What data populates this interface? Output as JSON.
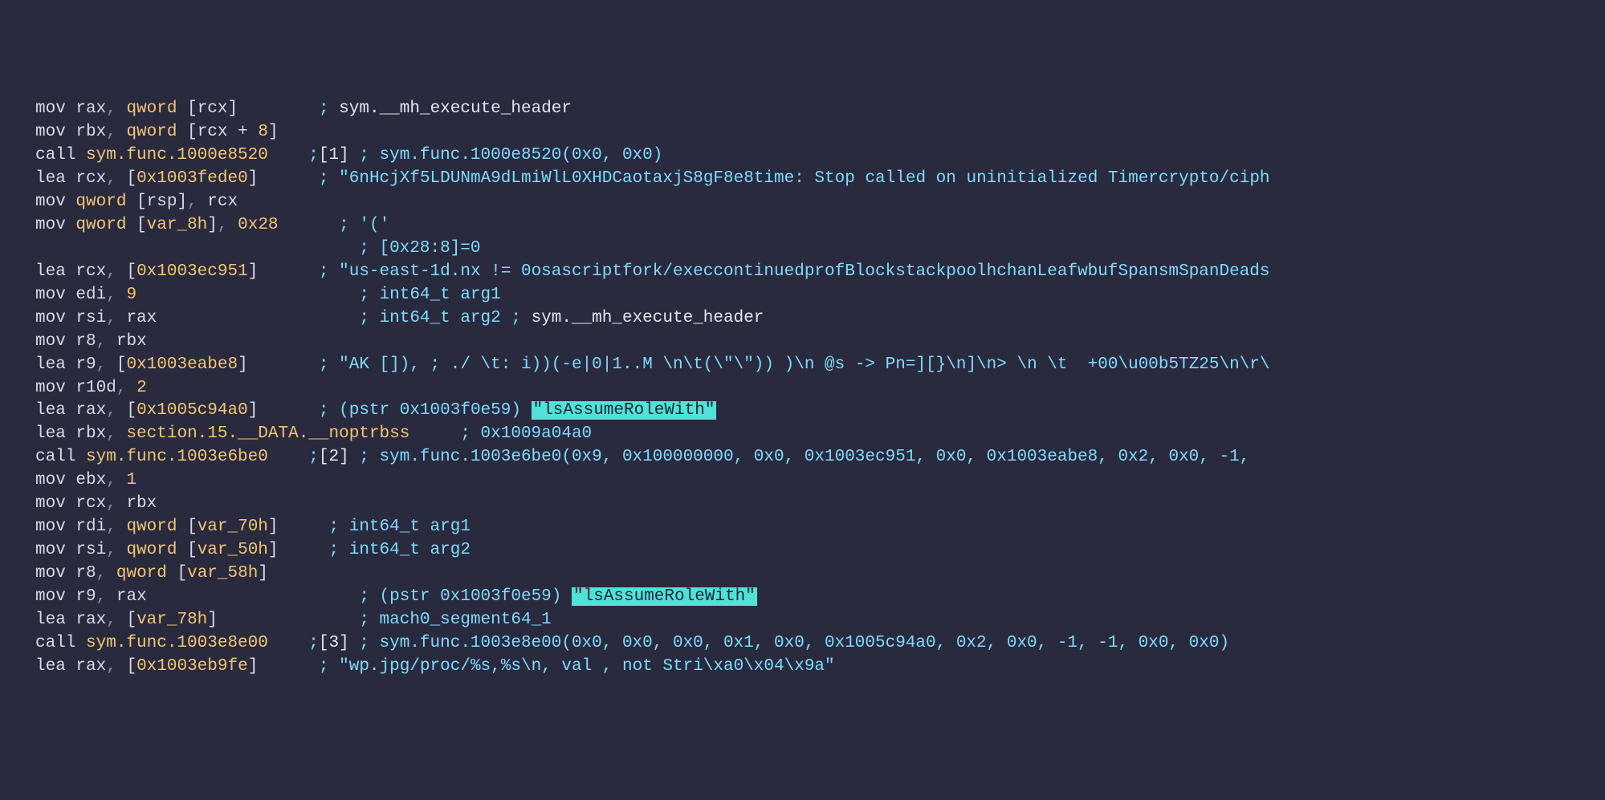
{
  "lines": [
    {
      "indent": 0,
      "instr": [
        {
          "t": "op",
          "v": "mov "
        },
        {
          "t": "reg",
          "v": "rax"
        },
        {
          "t": "comma",
          "v": ", "
        },
        {
          "t": "kw",
          "v": "qword "
        },
        {
          "t": "bracket",
          "v": "["
        },
        {
          "t": "reg",
          "v": "rcx"
        },
        {
          "t": "bracket",
          "v": "]"
        }
      ],
      "pad": 8,
      "comment_parts": [
        {
          "t": "cmt",
          "v": "; "
        },
        {
          "t": "cmt-white",
          "v": "sym.__mh_execute_header"
        }
      ]
    },
    {
      "indent": 0,
      "instr": [
        {
          "t": "op",
          "v": "mov "
        },
        {
          "t": "reg",
          "v": "rbx"
        },
        {
          "t": "comma",
          "v": ", "
        },
        {
          "t": "kw",
          "v": "qword "
        },
        {
          "t": "bracket",
          "v": "["
        },
        {
          "t": "reg",
          "v": "rcx "
        },
        {
          "t": "plus",
          "v": "+ "
        },
        {
          "t": "num",
          "v": "8"
        },
        {
          "t": "bracket",
          "v": "]"
        }
      ],
      "pad": 0,
      "comment_parts": []
    },
    {
      "indent": 0,
      "instr": [
        {
          "t": "op",
          "v": "call "
        },
        {
          "t": "call",
          "v": "sym.func.1000e8520"
        }
      ],
      "pad": 4,
      "comment_parts": [
        {
          "t": "cmt",
          "v": ";"
        },
        {
          "t": "cmt-bracket",
          "v": "[1]"
        },
        {
          "t": "cmt",
          "v": " ; sym.func.1000e8520(0x0, 0x0)"
        }
      ]
    },
    {
      "indent": 0,
      "instr": [
        {
          "t": "op",
          "v": "lea "
        },
        {
          "t": "reg",
          "v": "rcx"
        },
        {
          "t": "comma",
          "v": ", "
        },
        {
          "t": "bracket",
          "v": "["
        },
        {
          "t": "num",
          "v": "0x1003fede0"
        },
        {
          "t": "bracket",
          "v": "]"
        }
      ],
      "pad": 6,
      "comment_parts": [
        {
          "t": "cmt",
          "v": "; "
        },
        {
          "t": "cmt",
          "v": "\"6nHcjXf5LDUNmA9dLmiWlL0XHDCaotaxjS8gF8e8time: Stop called on uninitialized Timercrypto/ciph"
        }
      ]
    },
    {
      "indent": 0,
      "instr": [
        {
          "t": "op",
          "v": "mov "
        },
        {
          "t": "kw",
          "v": "qword "
        },
        {
          "t": "bracket",
          "v": "["
        },
        {
          "t": "reg",
          "v": "rsp"
        },
        {
          "t": "bracket",
          "v": "]"
        },
        {
          "t": "comma",
          "v": ", "
        },
        {
          "t": "reg",
          "v": "rcx"
        }
      ],
      "pad": 0,
      "comment_parts": []
    },
    {
      "indent": 0,
      "instr": [
        {
          "t": "op",
          "v": "mov "
        },
        {
          "t": "kw",
          "v": "qword "
        },
        {
          "t": "bracket",
          "v": "["
        },
        {
          "t": "var",
          "v": "var_8h"
        },
        {
          "t": "bracket",
          "v": "]"
        },
        {
          "t": "comma",
          "v": ", "
        },
        {
          "t": "num",
          "v": "0x28"
        }
      ],
      "pad": 6,
      "comment_parts": [
        {
          "t": "cmt",
          "v": "; '('"
        }
      ]
    },
    {
      "indent": 0,
      "instr": [],
      "pad": 32,
      "comment_parts": [
        {
          "t": "cmt",
          "v": "; [0x28:8]=0"
        }
      ]
    },
    {
      "indent": 0,
      "instr": [
        {
          "t": "op",
          "v": "lea "
        },
        {
          "t": "reg",
          "v": "rcx"
        },
        {
          "t": "comma",
          "v": ", "
        },
        {
          "t": "bracket",
          "v": "["
        },
        {
          "t": "num",
          "v": "0x1003ec951"
        },
        {
          "t": "bracket",
          "v": "]"
        }
      ],
      "pad": 6,
      "comment_parts": [
        {
          "t": "cmt",
          "v": "; \"us-east-1d.nx != 0osascriptfork/execcontinuedprofBlockstackpoolhchanLeafwbufSpansmSpanDeads"
        }
      ]
    },
    {
      "indent": 0,
      "instr": [
        {
          "t": "op",
          "v": "mov "
        },
        {
          "t": "reg",
          "v": "edi"
        },
        {
          "t": "comma",
          "v": ", "
        },
        {
          "t": "num",
          "v": "9"
        }
      ],
      "pad": 22,
      "comment_parts": [
        {
          "t": "cmt",
          "v": "; int64_t arg1"
        }
      ]
    },
    {
      "indent": 0,
      "instr": [
        {
          "t": "op",
          "v": "mov "
        },
        {
          "t": "reg",
          "v": "rsi"
        },
        {
          "t": "comma",
          "v": ", "
        },
        {
          "t": "reg",
          "v": "rax"
        }
      ],
      "pad": 20,
      "comment_parts": [
        {
          "t": "cmt",
          "v": "; int64_t arg2 ; "
        },
        {
          "t": "cmt-white",
          "v": "sym.__mh_execute_header"
        }
      ]
    },
    {
      "indent": 0,
      "instr": [
        {
          "t": "op",
          "v": "mov "
        },
        {
          "t": "reg",
          "v": "r8"
        },
        {
          "t": "comma",
          "v": ", "
        },
        {
          "t": "reg",
          "v": "rbx"
        }
      ],
      "pad": 0,
      "comment_parts": []
    },
    {
      "indent": 0,
      "instr": [
        {
          "t": "op",
          "v": "lea "
        },
        {
          "t": "reg",
          "v": "r9"
        },
        {
          "t": "comma",
          "v": ", "
        },
        {
          "t": "bracket",
          "v": "["
        },
        {
          "t": "num",
          "v": "0x1003eabe8"
        },
        {
          "t": "bracket",
          "v": "]"
        }
      ],
      "pad": 7,
      "comment_parts": [
        {
          "t": "cmt",
          "v": "; \"AK []), ; ./ \\t: i))(-e|0|1..M \\n\\t(\\\"\\\")) )\\n @s -> Pn=][}\\n]\\n> \\n \\t  +00\\u00b5TZ25\\n\\r\\"
        }
      ]
    },
    {
      "indent": 0,
      "instr": [
        {
          "t": "op",
          "v": "mov "
        },
        {
          "t": "reg",
          "v": "r10d"
        },
        {
          "t": "comma",
          "v": ", "
        },
        {
          "t": "num",
          "v": "2"
        }
      ],
      "pad": 0,
      "comment_parts": []
    },
    {
      "indent": 0,
      "instr": [
        {
          "t": "op",
          "v": "lea "
        },
        {
          "t": "reg",
          "v": "rax"
        },
        {
          "t": "comma",
          "v": ", "
        },
        {
          "t": "bracket",
          "v": "["
        },
        {
          "t": "num",
          "v": "0x1005c94a0"
        },
        {
          "t": "bracket",
          "v": "]"
        }
      ],
      "pad": 6,
      "comment_parts": [
        {
          "t": "cmt",
          "v": "; (pstr 0x1003f0e59) "
        },
        {
          "t": "hl",
          "v": "\"lsAssumeRoleWith\""
        }
      ]
    },
    {
      "indent": 0,
      "instr": [
        {
          "t": "op",
          "v": "lea "
        },
        {
          "t": "reg",
          "v": "rbx"
        },
        {
          "t": "comma",
          "v": ", "
        },
        {
          "t": "sect",
          "v": "section.15.__DATA.__noptrbss"
        }
      ],
      "pad": 5,
      "comment_parts": [
        {
          "t": "cmt",
          "v": "; 0x1009a04a0"
        }
      ]
    },
    {
      "indent": 0,
      "instr": [
        {
          "t": "op",
          "v": "call "
        },
        {
          "t": "call",
          "v": "sym.func.1003e6be0"
        }
      ],
      "pad": 4,
      "comment_parts": [
        {
          "t": "cmt",
          "v": ";"
        },
        {
          "t": "cmt-bracket",
          "v": "[2]"
        },
        {
          "t": "cmt",
          "v": " ; sym.func.1003e6be0(0x9, 0x100000000, 0x0, 0x1003ec951, 0x0, 0x1003eabe8, 0x2, 0x0, -1,"
        }
      ]
    },
    {
      "indent": 0,
      "instr": [
        {
          "t": "op",
          "v": "mov "
        },
        {
          "t": "reg",
          "v": "ebx"
        },
        {
          "t": "comma",
          "v": ", "
        },
        {
          "t": "num",
          "v": "1"
        }
      ],
      "pad": 0,
      "comment_parts": []
    },
    {
      "indent": 0,
      "instr": [
        {
          "t": "op",
          "v": "mov "
        },
        {
          "t": "reg",
          "v": "rcx"
        },
        {
          "t": "comma",
          "v": ", "
        },
        {
          "t": "reg",
          "v": "rbx"
        }
      ],
      "pad": 0,
      "comment_parts": []
    },
    {
      "indent": 0,
      "instr": [
        {
          "t": "op",
          "v": "mov "
        },
        {
          "t": "reg",
          "v": "rdi"
        },
        {
          "t": "comma",
          "v": ", "
        },
        {
          "t": "kw",
          "v": "qword "
        },
        {
          "t": "bracket",
          "v": "["
        },
        {
          "t": "var",
          "v": "var_70h"
        },
        {
          "t": "bracket",
          "v": "]"
        }
      ],
      "pad": 5,
      "comment_parts": [
        {
          "t": "cmt",
          "v": "; int64_t arg1"
        }
      ]
    },
    {
      "indent": 0,
      "instr": [
        {
          "t": "op",
          "v": "mov "
        },
        {
          "t": "reg",
          "v": "rsi"
        },
        {
          "t": "comma",
          "v": ", "
        },
        {
          "t": "kw",
          "v": "qword "
        },
        {
          "t": "bracket",
          "v": "["
        },
        {
          "t": "var",
          "v": "var_50h"
        },
        {
          "t": "bracket",
          "v": "]"
        }
      ],
      "pad": 5,
      "comment_parts": [
        {
          "t": "cmt",
          "v": "; int64_t arg2"
        }
      ]
    },
    {
      "indent": 0,
      "instr": [
        {
          "t": "op",
          "v": "mov "
        },
        {
          "t": "reg",
          "v": "r8"
        },
        {
          "t": "comma",
          "v": ", "
        },
        {
          "t": "kw",
          "v": "qword "
        },
        {
          "t": "bracket",
          "v": "["
        },
        {
          "t": "var",
          "v": "var_58h"
        },
        {
          "t": "bracket",
          "v": "]"
        }
      ],
      "pad": 0,
      "comment_parts": []
    },
    {
      "indent": 0,
      "instr": [
        {
          "t": "op",
          "v": "mov "
        },
        {
          "t": "reg",
          "v": "r9"
        },
        {
          "t": "comma",
          "v": ", "
        },
        {
          "t": "reg",
          "v": "rax"
        }
      ],
      "pad": 21,
      "comment_parts": [
        {
          "t": "cmt",
          "v": "; (pstr 0x1003f0e59) "
        },
        {
          "t": "hl",
          "v": "\"lsAssumeRoleWith\""
        }
      ]
    },
    {
      "indent": 0,
      "instr": [
        {
          "t": "op",
          "v": "lea "
        },
        {
          "t": "reg",
          "v": "rax"
        },
        {
          "t": "comma",
          "v": ", "
        },
        {
          "t": "bracket",
          "v": "["
        },
        {
          "t": "var",
          "v": "var_78h"
        },
        {
          "t": "bracket",
          "v": "]"
        }
      ],
      "pad": 14,
      "comment_parts": [
        {
          "t": "cmt",
          "v": "; mach0_segment64_1"
        }
      ]
    },
    {
      "indent": 0,
      "instr": [
        {
          "t": "op",
          "v": "call "
        },
        {
          "t": "call",
          "v": "sym.func.1003e8e00"
        }
      ],
      "pad": 4,
      "comment_parts": [
        {
          "t": "cmt",
          "v": ";"
        },
        {
          "t": "cmt-bracket",
          "v": "[3]"
        },
        {
          "t": "cmt",
          "v": " ; sym.func.1003e8e00(0x0, 0x0, 0x0, 0x1, 0x0, 0x1005c94a0, 0x2, 0x0, -1, -1, 0x0, 0x0)"
        }
      ]
    },
    {
      "indent": 0,
      "instr": [
        {
          "t": "op",
          "v": "lea "
        },
        {
          "t": "reg",
          "v": "rax"
        },
        {
          "t": "comma",
          "v": ", "
        },
        {
          "t": "bracket",
          "v": "["
        },
        {
          "t": "num",
          "v": "0x1003eb9fe"
        },
        {
          "t": "bracket",
          "v": "]"
        }
      ],
      "pad": 6,
      "comment_parts": [
        {
          "t": "cmt",
          "v": "; \"wp.jpg/proc/%s,%s\\n, val , not Stri\\xa0\\x04\\x9a\""
        }
      ]
    }
  ]
}
